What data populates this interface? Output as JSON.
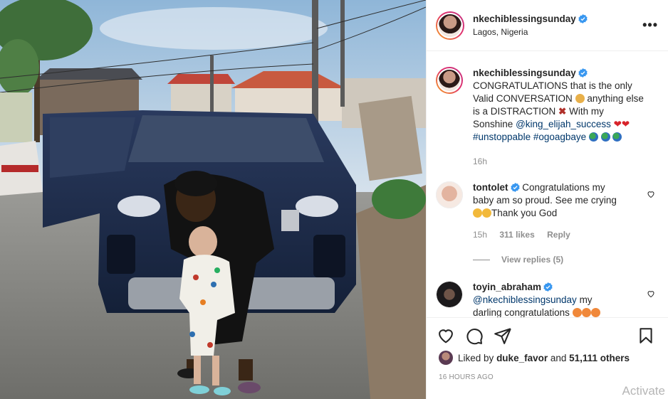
{
  "post": {
    "username": "nkechiblessingsunday",
    "location": "Lagos, Nigeria",
    "more_label": "•••",
    "caption": {
      "username": "nkechiblessingsunday",
      "line1": "CONGRATULATIONS that is the only",
      "line2": "Valid CONVERSATION",
      "line2b": "anything else",
      "line3": "is a DISTRACTION",
      "line3b": "With my",
      "line4": "Sonshine",
      "mention": "@king_elijah_success",
      "hashtags": "#unstoppable #ogoagbaye",
      "age": "16h"
    },
    "comments": [
      {
        "username": "tontolet",
        "text1": "Congratulations my",
        "text2": "baby am so proud. See me crying",
        "text3": "Thank you God",
        "age": "15h",
        "likes": "311 likes",
        "reply": "Reply",
        "view_replies": "View replies (5)"
      },
      {
        "username": "toyin_abraham",
        "mention": "@nkechiblessingsunday",
        "text1": "my",
        "text2": "darling congratulations"
      }
    ],
    "likes": {
      "prefix": "Liked by",
      "user": "duke_favor",
      "and": "and",
      "count": "51,111 others"
    },
    "timestamp": "16 HOURS AGO"
  },
  "overlay": {
    "watermark": "Activate"
  },
  "colors": {
    "verified": "#3897f0",
    "link": "#00376b",
    "muted": "#8e8e8e",
    "heart": "#ed4956"
  },
  "icons": [
    "like-icon",
    "comment-icon",
    "share-icon",
    "save-icon",
    "verified-icon",
    "more-options-icon"
  ]
}
